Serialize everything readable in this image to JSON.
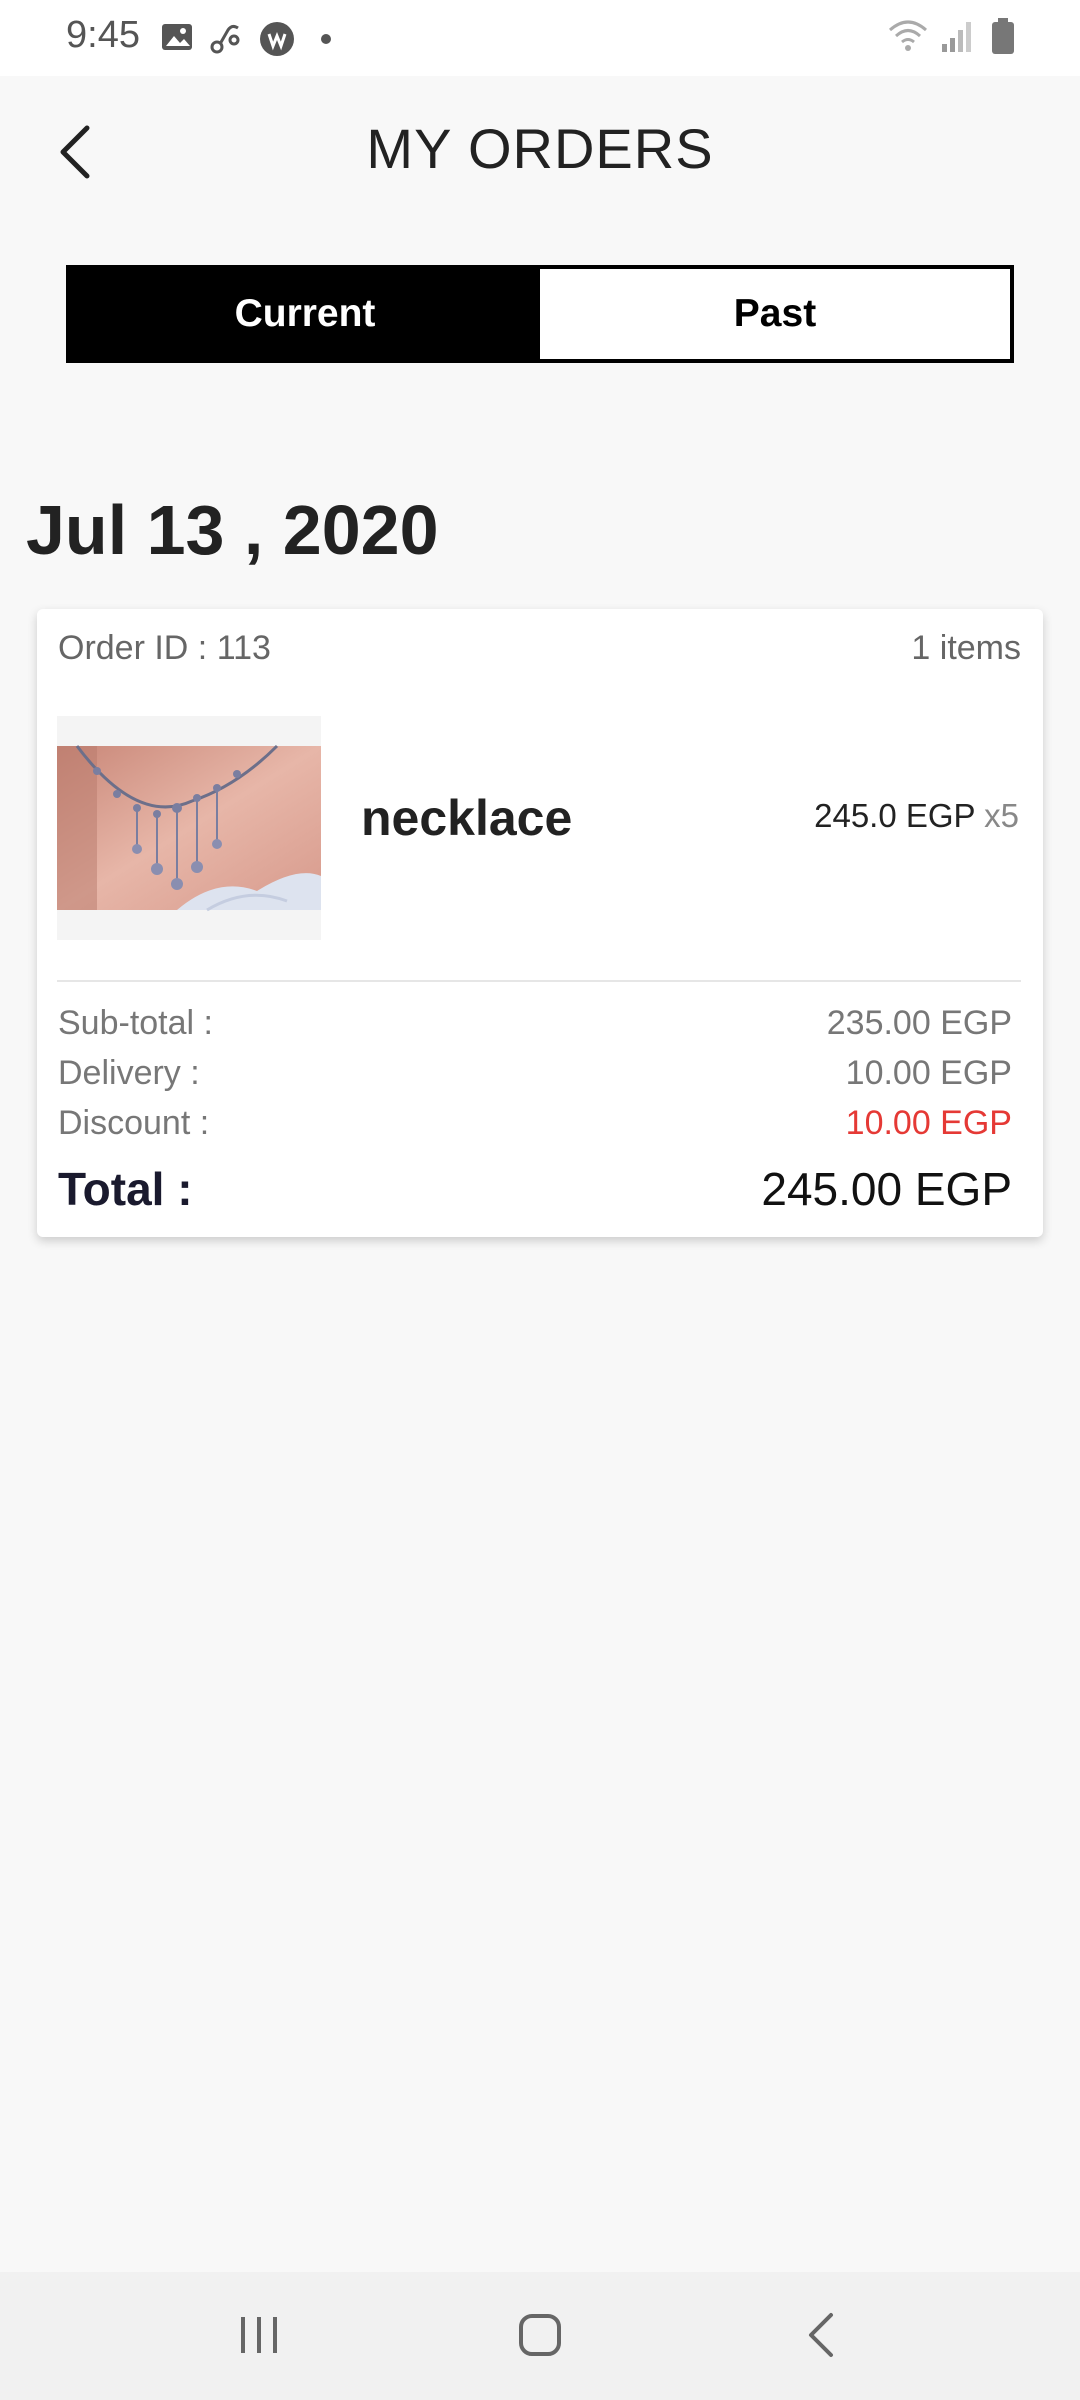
{
  "status_bar": {
    "time": "9:45",
    "icons_left": [
      "gallery-icon",
      "link-icon",
      "app-icon",
      "dot-icon"
    ],
    "icons_right": [
      "wifi-icon",
      "signal-icon",
      "battery-icon"
    ]
  },
  "header": {
    "title": "MY ORDERS",
    "back_icon": "chevron-left-icon"
  },
  "tabs": [
    {
      "label": "Current",
      "active": true
    },
    {
      "label": "Past",
      "active": false
    }
  ],
  "orders": [
    {
      "date": "Jul 13 , 2020",
      "order_id_label": "Order ID : 113",
      "items_count": "1 items",
      "products": [
        {
          "name": "necklace",
          "price": "245.0 EGP",
          "quantity": "x5"
        }
      ],
      "summary": {
        "subtotal_label": "Sub-total :",
        "subtotal_value": "235.00 EGP",
        "delivery_label": "Delivery :",
        "delivery_value": "10.00 EGP",
        "discount_label": "Discount :",
        "discount_value": "10.00 EGP",
        "total_label": "Total :",
        "total_value": "245.00 EGP"
      }
    }
  ],
  "nav_bar": {
    "buttons": [
      "recent-apps-icon",
      "home-icon",
      "back-icon"
    ]
  },
  "colors": {
    "discount": "#e53935",
    "tab_active_bg": "#000000",
    "background": "#f8f8f8"
  }
}
